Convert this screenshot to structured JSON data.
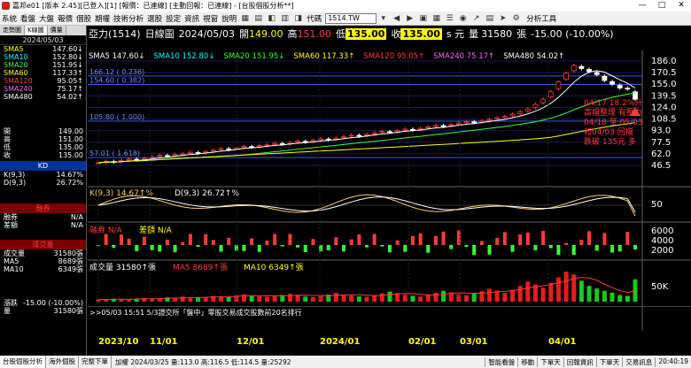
{
  "window": {
    "title": "嘉邦e01 [版本 2.45][已登入][1] [報價：已連線] [主動回報：已連線] - [台股個股分析**]",
    "minimize": "—",
    "maximize": "□",
    "close": "✕"
  },
  "menu": {
    "items": [
      "系統",
      "看盤",
      "大盤",
      "報價",
      "個股",
      "期權",
      "技術分析",
      "選股",
      "設定",
      "資訊",
      "視窗",
      "說明"
    ],
    "code_label": "代碼",
    "code_value": "1514.TW",
    "tools_label": "分析工具"
  },
  "left_panel": {
    "tabs": [
      "走勢圖",
      "K線圖",
      "價量"
    ],
    "active_tab": 1,
    "date": "2024/05/03",
    "ma_rows": [
      {
        "label": "SMA5",
        "value": "147.60",
        "arrow": "↓",
        "color": "#ffff00"
      },
      {
        "label": "SMA10",
        "value": "152.80",
        "arrow": "↓",
        "color": "#00ffff"
      },
      {
        "label": "SMA20",
        "value": "151.95",
        "arrow": "↓",
        "color": "#39ff39"
      },
      {
        "label": "SMA60",
        "value": "117.33",
        "arrow": "↑",
        "color": "#ffff00"
      },
      {
        "label": "SMA120",
        "value": "95.05",
        "arrow": "↑",
        "color": "#ff3b3b"
      },
      {
        "label": "SMA240",
        "value": "75.17",
        "arrow": "↑",
        "color": "#ff66ff"
      },
      {
        "label": "SMA480",
        "value": "54.02",
        "arrow": "↑",
        "color": "#ffffff"
      }
    ],
    "ohlc": [
      {
        "label": "開",
        "value": "149.00"
      },
      {
        "label": "高",
        "value": "151.00"
      },
      {
        "label": "低",
        "value": "135.00"
      },
      {
        "label": "收",
        "value": "135.00"
      }
    ],
    "kd_title": "KD",
    "kd_rows": [
      {
        "label": "K(9,3)",
        "value": "14.67%"
      },
      {
        "label": "D(9,3)",
        "value": "26.72%"
      }
    ],
    "margin_title": "融券",
    "margin_rows": [
      {
        "label": "融券",
        "value": "N/A"
      },
      {
        "label": "差額",
        "value": "N/A"
      }
    ],
    "volume_title": "成交量",
    "volume_rows": [
      {
        "label": "成交量",
        "value": "31580張"
      },
      {
        "label": "MA5",
        "value": "8689張"
      },
      {
        "label": "MA10",
        "value": "6349張"
      }
    ],
    "change_rows": [
      {
        "label": "漲跌",
        "value": "-15.00 (-10.00%)"
      },
      {
        "label": "量",
        "value": "31580張"
      }
    ]
  },
  "headline": {
    "stock": "亞力(1514)",
    "period": "日線圖",
    "date": "2024/05/03",
    "open_label": "開",
    "open": "149.00",
    "high_label": "高",
    "high": "151.00",
    "low_label": "低",
    "low": "135.00",
    "close_label": "收",
    "close": "135.00",
    "unit": "s 元",
    "volume_label": "量",
    "volume": "31580",
    "volume_unit": "張",
    "change": "-15.00 (-10.00%)"
  },
  "sma_legend": [
    {
      "text": "SMA5 147.60↓",
      "color": "#ffffff"
    },
    {
      "text": "SMA10 152.80↓",
      "color": "#00ffff"
    },
    {
      "text": "SMA20 151.95↓",
      "color": "#39ff39"
    },
    {
      "text": "SMA60 117.33↑",
      "color": "#ffff00"
    },
    {
      "text": "SMA120 95.05↑",
      "color": "#ff3b3b"
    },
    {
      "text": "SMA240 75.17↑",
      "color": "#ff66ff"
    },
    {
      "text": "SMA480 54.02↑",
      "color": "#ffffff"
    }
  ],
  "price_axis_labels": [
    "186.0",
    "170.5",
    "155.0",
    "139.5",
    "124.0",
    "108.5",
    "93.0",
    "77.5",
    "62.0",
    "46.5"
  ],
  "fib_lines": [
    {
      "label": "166.12 ( 0.236)",
      "price": 166.12
    },
    {
      "label": "154.60 ( 0.382)",
      "price": 154.6
    },
    {
      "label": "105.80 ( 1.000)",
      "price": 105.8
    },
    {
      "label": "57.01 ( 1.618)",
      "price": 57.01
    }
  ],
  "annotation_lines": [
    "04/17 18.2%升",
    "高檔整理 有壓力",
    "04/18 至 05/03",
    "和04/03 回檔",
    "跌破 135元 多"
  ],
  "kd_legend": {
    "k": "K(9,3) 14.67↑%",
    "d": "D(9,3) 26.72↑%"
  },
  "kd_axis_label": "50",
  "margin_legend": {
    "margin": "融券 N/A",
    "diff": "差額 N/A"
  },
  "margin_axis_labels": [
    "6000",
    "4000",
    "2000"
  ],
  "volume_legend": {
    "vol": "成交量 31580↑張",
    "ma5": "MA5 8689↑張",
    "ma10": "MA10 6349↑張"
  },
  "volume_axis_label": "50K",
  "date_axis_labels": [
    "2023/10",
    "11/01",
    "12/01",
    "2024/01",
    "02/01",
    "03/01",
    "04/01"
  ],
  "news_text": ">>05/03 15:51  5/3證交所「盤中」零股交易成交股數前20名排行",
  "statusbar": {
    "tabs": [
      "台股個股分析",
      "海外個股",
      "完整下單"
    ],
    "quote": "加權 2024/03/25 量:113.0 高:116.5 低:114.5 量:25292",
    "right_items": [
      "智能看盤",
      "移動",
      "下單天",
      "回報資訊",
      "下單天",
      "交易訊息"
    ],
    "time": "20:40:19"
  },
  "chart_data": [
    {
      "type": "candlestick",
      "title": "亞力(1514) 日線圖",
      "ylim": [
        46.5,
        186.0
      ],
      "x_labels": [
        "2023/10",
        "11/01",
        "12/01",
        "2024/01",
        "02/01",
        "03/01",
        "04/01"
      ],
      "close_series": [
        50,
        52,
        51,
        53,
        55,
        54,
        56,
        58,
        60,
        59,
        61,
        62,
        64,
        63,
        65,
        67,
        69,
        68,
        70,
        72,
        71,
        73,
        74,
        76,
        75,
        77,
        79,
        78,
        80,
        82,
        81,
        83,
        85,
        87,
        86,
        88,
        90,
        92,
        91,
        93,
        95,
        94,
        96,
        98,
        100,
        99,
        101,
        103,
        105,
        104,
        106,
        108,
        110,
        112,
        115,
        118,
        122,
        128,
        135,
        145,
        158,
        170,
        180,
        176,
        172,
        168,
        160,
        155,
        150,
        149,
        135
      ]
    },
    {
      "type": "line",
      "title": "KD",
      "series": [
        {
          "name": "K(9,3)",
          "last": 14.67
        },
        {
          "name": "D(9,3)",
          "last": 26.72
        }
      ],
      "ylim": [
        0,
        100
      ]
    },
    {
      "type": "bar",
      "title": "成交量",
      "ylabel": "張",
      "last_volume": 31580,
      "ma5": 8689,
      "ma10": 6349,
      "values": [
        3200,
        2800,
        4100,
        3600,
        2900,
        4500,
        5200,
        3800,
        4400,
        6100,
        5300,
        7200,
        4800,
        5900,
        6600,
        8100,
        7400,
        6200,
        9000,
        10500,
        8800,
        7600,
        6900,
        8200,
        9400,
        11200,
        9800,
        7200,
        6500,
        8300,
        10100,
        12400,
        9900,
        8700,
        7400,
        6800,
        9200,
        11800,
        14200,
        12300,
        9600,
        8400,
        7100,
        9800,
        12600,
        15400,
        13200,
        10500,
        9200,
        11400,
        14800,
        18200,
        15600,
        12400,
        16800,
        22400,
        28600,
        24200,
        19800,
        26400,
        34200,
        42600,
        38400,
        29600,
        22400,
        18600,
        15200,
        12800,
        9400,
        8200,
        31580
      ]
    }
  ]
}
